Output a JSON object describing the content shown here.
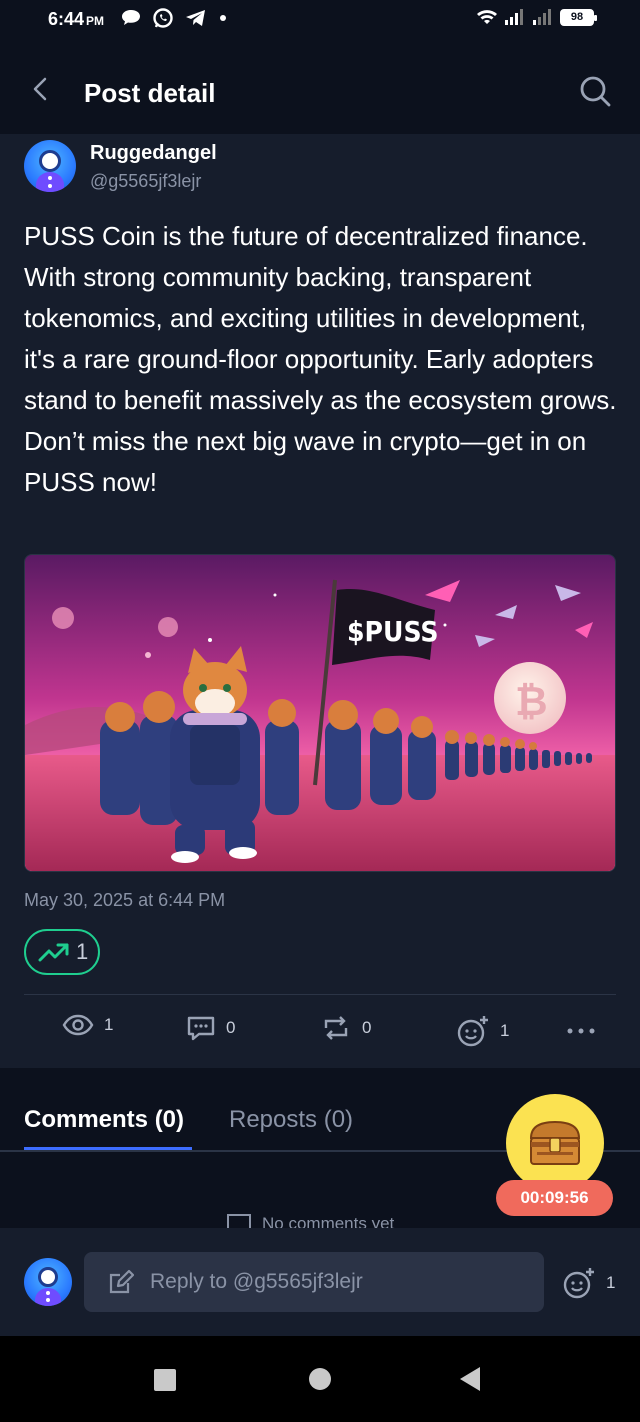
{
  "status_bar": {
    "time": "6:44",
    "ampm": "PM",
    "battery": "98"
  },
  "header": {
    "title": "Post detail"
  },
  "post": {
    "author_name": "Ruggedangel",
    "author_handle": "@g5565jf3lejr",
    "text": "PUSS Coin is the future of decentralized finance. With strong community backing, transparent tokenomics, and exciting utilities in development, it's a rare ground-floor opportunity. Early adopters stand to benefit massively as the ecosystem grows. Don’t miss the next big wave in crypto—get in on PUSS now!",
    "image_flag_text": "$PUSS",
    "date": "May 30, 2025 at 6:44 PM",
    "trend_count": "1",
    "stats": {
      "views": "1",
      "comments": "0",
      "reposts": "0",
      "reactions": "1"
    }
  },
  "tabs": {
    "comments": "Comments (0)",
    "reposts": "Reposts (0)"
  },
  "empty_message": "No comments yet",
  "timer": "00:09:56",
  "reply": {
    "placeholder": "Reply to @g5565jf3lejr",
    "reaction_count": "1"
  },
  "colors": {
    "accent": "#3d6dff",
    "trend": "#1fce8f",
    "timer": "#f06a5c",
    "chest": "#fbe251"
  }
}
